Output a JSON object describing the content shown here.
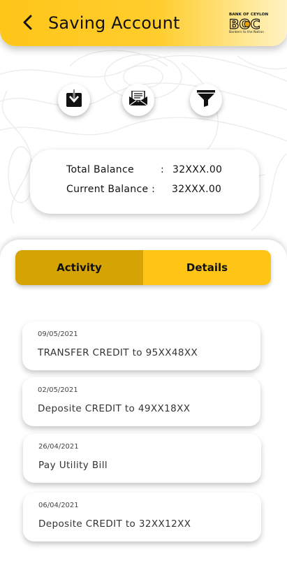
{
  "header": {
    "title": "Saving Account",
    "back_icon": "chevron-left-icon",
    "logo": {
      "bank_name": "BANK OF CEYLON",
      "mark": "BOC",
      "tagline": "Bankers to the Nation"
    }
  },
  "actions": [
    {
      "name": "download",
      "icon": "download-icon"
    },
    {
      "name": "email",
      "icon": "envelope-icon"
    },
    {
      "name": "filter",
      "icon": "filter-icon"
    }
  ],
  "balance": {
    "total_label": "Total Balance",
    "total_sep": ":",
    "total_value": "32XXX.00",
    "current_label": "Current Balance :",
    "current_value": "32XXX.00"
  },
  "tabs": {
    "activity": "Activity",
    "details": "Details",
    "selected": "Activity"
  },
  "transactions": [
    {
      "date": "09/05/2021",
      "description": "TRANSFER CREDIT  to 95XX48XX"
    },
    {
      "date": "02/05/2021",
      "description": "Deposite CREDIT  to 49XX18XX"
    },
    {
      "date": "26/04/2021",
      "description": "Pay Utility Bill"
    },
    {
      "date": "06/04/2021",
      "description": "Deposite CREDIT  to 32XX12XX"
    }
  ],
  "colors": {
    "brand_yellow": "#ffc61a",
    "tab_active": "#d6a305",
    "tab_inactive": "#fec517"
  }
}
